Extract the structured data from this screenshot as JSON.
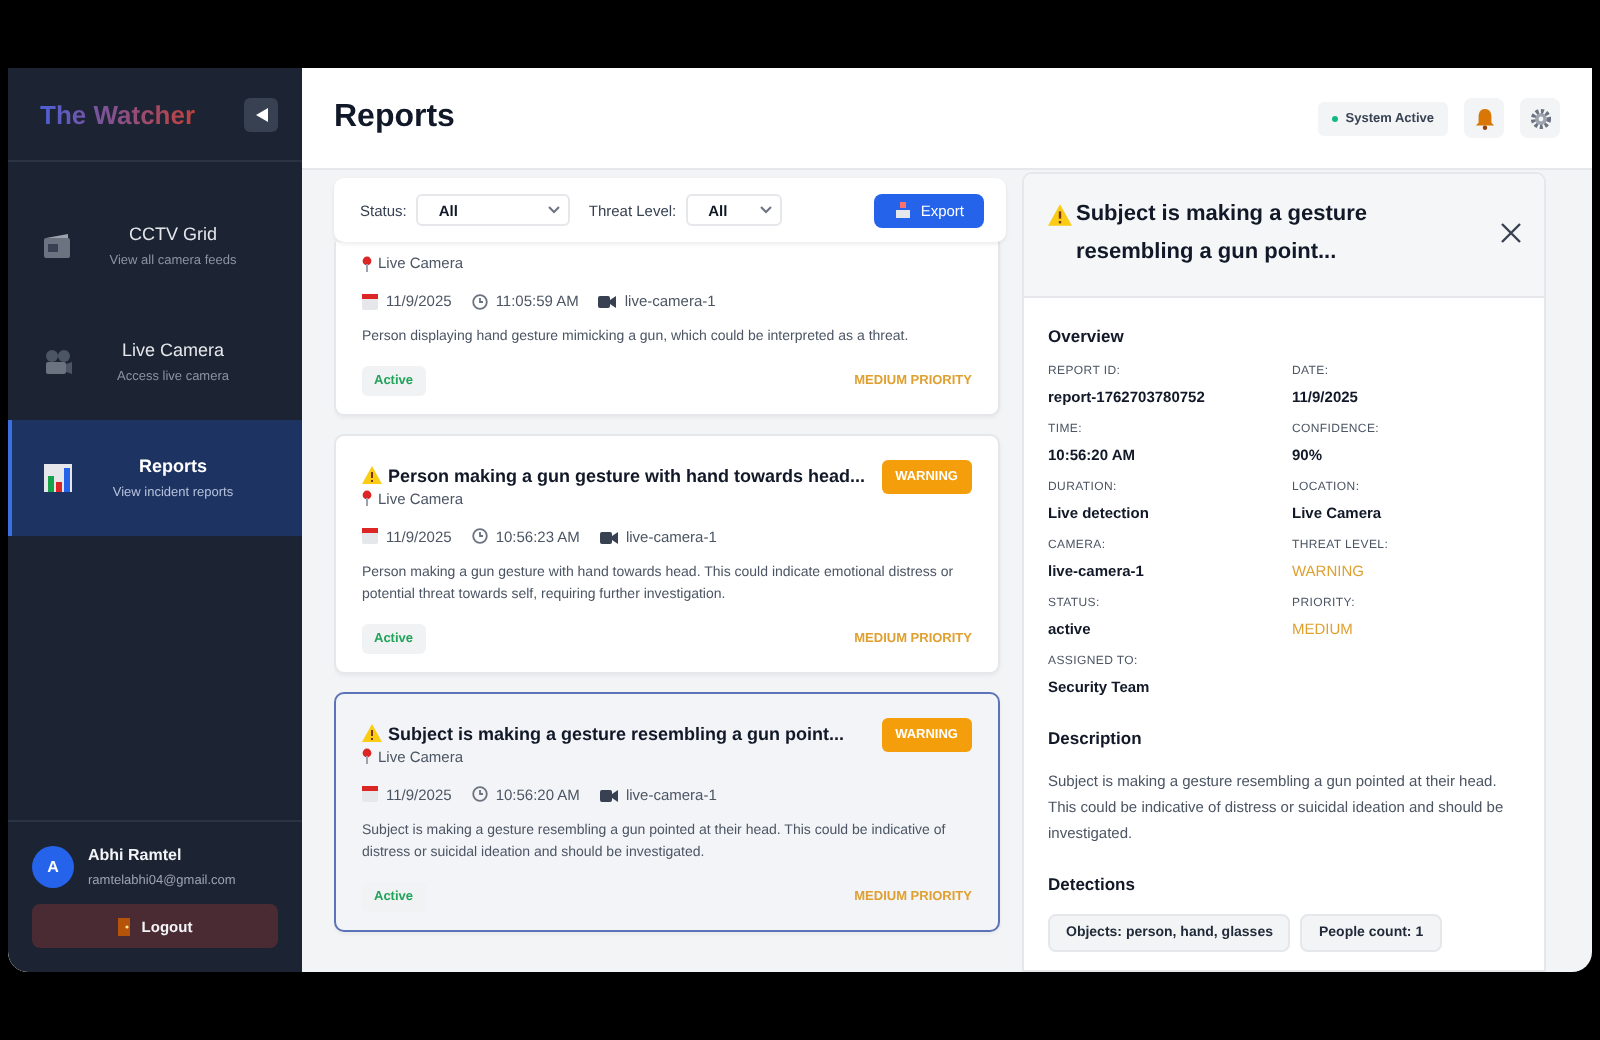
{
  "sidebar": {
    "logo": "The Watcher",
    "items": [
      {
        "kind": "film",
        "title": "CCTV Grid",
        "subtitle": "View all camera feeds",
        "selected": false
      },
      {
        "kind": "camera",
        "title": "Live Camera",
        "subtitle": "Access live camera",
        "selected": false
      },
      {
        "kind": "chart",
        "title": "Reports",
        "subtitle": "View incident reports",
        "selected": true
      }
    ],
    "user": {
      "initial": "A",
      "name": "Abhi Ramtel",
      "email": "ramtelabhi04@gmail.com"
    },
    "logout": "Logout"
  },
  "header": {
    "title": "Reports",
    "status": "System Active"
  },
  "filters": {
    "status_label": "Status:",
    "status_value": "All",
    "threat_label": "Threat Level:",
    "threat_value": "All",
    "export": "Export"
  },
  "reports": [
    {
      "location": "Live Camera",
      "date": "11/9/2025",
      "time": "11:05:59 AM",
      "camera": "live-camera-1",
      "description": "Person displaying hand gesture mimicking a gun, which could be interpreted as a threat.",
      "status": "Active",
      "priority": "MEDIUM PRIORITY",
      "selected": false
    },
    {
      "title": "Person making a gun gesture with hand towards head...",
      "badge": "WARNING",
      "location": "Live Camera",
      "date": "11/9/2025",
      "time": "10:56:23 AM",
      "camera": "live-camera-1",
      "description": "Person making a gun gesture with hand towards head. This could indicate emotional distress or potential threat towards self, requiring further investigation.",
      "status": "Active",
      "priority": "MEDIUM PRIORITY",
      "selected": false
    },
    {
      "title": "Subject is making a gesture resembling a gun point...",
      "badge": "WARNING",
      "location": "Live Camera",
      "date": "11/9/2025",
      "time": "10:56:20 AM",
      "camera": "live-camera-1",
      "description": "Subject is making a gesture resembling a gun pointed at their head. This could be indicative of distress or suicidal ideation and should be investigated.",
      "status": "Active",
      "priority": "MEDIUM PRIORITY",
      "selected": true
    }
  ],
  "detail": {
    "title": "Subject is making a gesture resembling a gun point...",
    "overview_heading": "Overview",
    "fields": [
      {
        "label": "REPORT ID:",
        "value": "report-1762703780752",
        "highlight": false
      },
      {
        "label": "DATE:",
        "value": "11/9/2025",
        "highlight": false
      },
      {
        "label": "TIME:",
        "value": "10:56:20 AM",
        "highlight": false
      },
      {
        "label": "CONFIDENCE:",
        "value": "90%",
        "highlight": false
      },
      {
        "label": "DURATION:",
        "value": "Live detection",
        "highlight": false
      },
      {
        "label": "LOCATION:",
        "value": "Live Camera",
        "highlight": false
      },
      {
        "label": "CAMERA:",
        "value": "live-camera-1",
        "highlight": false
      },
      {
        "label": "THREAT LEVEL:",
        "value": "WARNING",
        "highlight": true
      },
      {
        "label": "STATUS:",
        "value": "active",
        "highlight": false
      },
      {
        "label": "PRIORITY:",
        "value": "MEDIUM",
        "highlight": true
      },
      {
        "label": "ASSIGNED TO:",
        "value": "Security Team",
        "highlight": false
      }
    ],
    "description_heading": "Description",
    "description": "Subject is making a gesture resembling a gun pointed at their head. This could be indicative of distress or suicidal ideation and should be investigated.",
    "detections_heading": "Detections",
    "detections": [
      "Objects: person, hand, glasses",
      "People count: 1"
    ]
  }
}
